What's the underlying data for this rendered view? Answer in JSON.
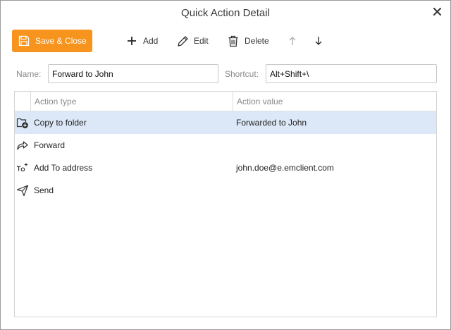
{
  "window": {
    "title": "Quick Action Detail"
  },
  "toolbar": {
    "save_label": "Save & Close",
    "add_label": "Add",
    "edit_label": "Edit",
    "delete_label": "Delete"
  },
  "fields": {
    "name_label": "Name:",
    "name_value": "Forward to John",
    "shortcut_label": "Shortcut:",
    "shortcut_value": "Alt+Shift+\\"
  },
  "grid": {
    "headers": [
      "Action type",
      "Action value"
    ],
    "rows": [
      {
        "icon": "copy-to-folder-icon",
        "type": "Copy to folder",
        "value": "Forwarded to John",
        "selected": true
      },
      {
        "icon": "forward-icon",
        "type": "Forward",
        "value": "",
        "selected": false
      },
      {
        "icon": "add-to-address-icon",
        "type": "Add To address",
        "value": "john.doe@e.emclient.com",
        "selected": false
      },
      {
        "icon": "send-icon",
        "type": "Send",
        "value": "",
        "selected": false
      }
    ]
  },
  "colors": {
    "accent": "#f7941d",
    "selection": "#dce8f7"
  }
}
